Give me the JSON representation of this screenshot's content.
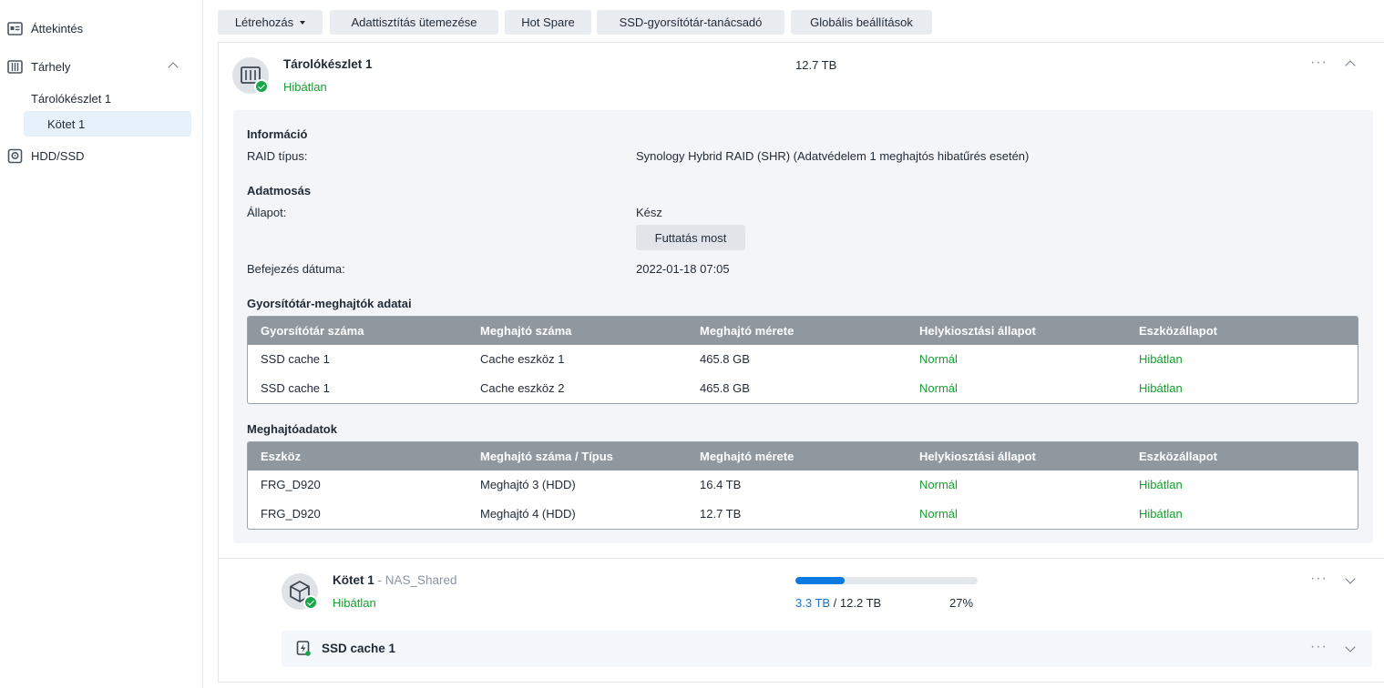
{
  "sidebar": {
    "overview": "Áttekintés",
    "storage": "Tárhely",
    "pool": "Tárolókészlet 1",
    "volume": "Kötet 1",
    "hdd": "HDD/SSD"
  },
  "toolbar": {
    "create": "Létrehozás",
    "scrub_schedule": "Adattisztítás ütemezése",
    "hot_spare": "Hot Spare",
    "ssd_advisor": "SSD-gyorsítótár-tanácsadó",
    "global_settings": "Globális beállítások"
  },
  "pool": {
    "name": "Tárolókészlet 1",
    "status": "Hibátlan",
    "size": "12.7 TB"
  },
  "info": {
    "section_title": "Információ",
    "raid_label": "RAID típus:",
    "raid_value": "Synology Hybrid RAID (SHR) (Adatvédelem 1 meghajtós hibatűrés esetén)"
  },
  "scrub": {
    "section_title": "Adatmosás",
    "state_label": "Állapot:",
    "state_value": "Kész",
    "run_button": "Futtatás most",
    "finished_label": "Befejezés dátuma:",
    "finished_value": "2022-01-18 07:05"
  },
  "cache_table": {
    "title": "Gyorsítótár-meghajtók adatai",
    "headers": [
      "Gyorsítótár száma",
      "Meghajtó száma",
      "Meghajtó mérete",
      "Helykiosztási állapot",
      "Eszközállapot"
    ],
    "rows": [
      [
        "SSD cache 1",
        "Cache eszköz 1",
        "465.8 GB",
        "Normál",
        "Hibátlan"
      ],
      [
        "SSD cache 1",
        "Cache eszköz 2",
        "465.8 GB",
        "Normál",
        "Hibátlan"
      ]
    ]
  },
  "drive_table": {
    "title": "Meghajtóadatok",
    "headers": [
      "Eszköz",
      "Meghajtó száma / Típus",
      "Meghajtó mérete",
      "Helykiosztási állapot",
      "Eszközállapot"
    ],
    "rows": [
      [
        "FRG_D920",
        "Meghajtó 3 (HDD)",
        "16.4 TB",
        "Normál",
        "Hibátlan"
      ],
      [
        "FRG_D920",
        "Meghajtó 4 (HDD)",
        "12.7 TB",
        "Normál",
        "Hibátlan"
      ]
    ]
  },
  "volume": {
    "name": "Kötet 1",
    "separator": " - ",
    "description": "NAS_Shared",
    "status": "Hibátlan",
    "used": "3.3 TB",
    "slash": " / ",
    "total": "12.2 TB",
    "percent_label": "27%",
    "usage_fraction": 0.27
  },
  "ssd_cache": {
    "name": "SSD cache 1"
  },
  "more_icon": "···",
  "colors": {
    "ok_green": "#14a02e",
    "accent_blue": "#0a7ae0",
    "table_header": "#8f979f"
  }
}
